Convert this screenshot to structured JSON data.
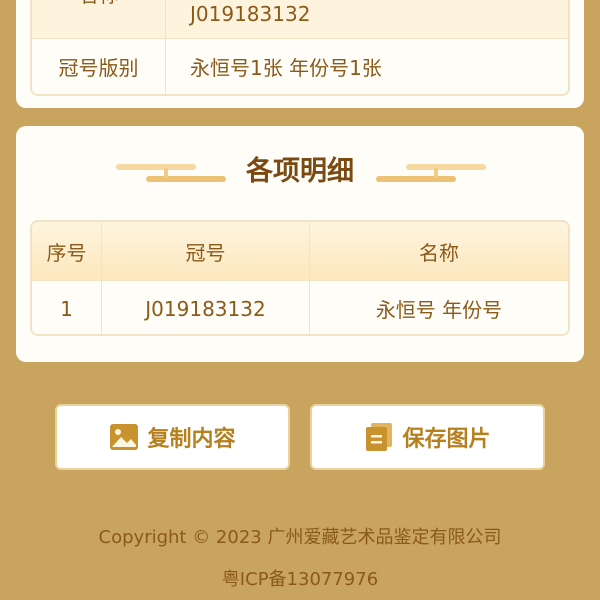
{
  "info_card": {
    "rows": [
      {
        "label": "名称",
        "value": "J019183132"
      },
      {
        "label": "冠号版别",
        "value": "永恒号1张 年份号1张"
      }
    ]
  },
  "detail_card": {
    "title": "各项明细",
    "columns": [
      "序号",
      "冠号",
      "名称"
    ],
    "rows": [
      {
        "index": "1",
        "serial": "J019183132",
        "name": "永恒号 年份号"
      }
    ]
  },
  "actions": {
    "copy_label": "复制内容",
    "copy_icon": "image-icon",
    "save_label": "保存图片",
    "save_icon": "document-icon"
  },
  "footer": {
    "copyright": "Copyright © 2023 广州爱藏艺术品鉴定有限公司",
    "icp": "粤ICP备13077976"
  },
  "colors": {
    "page_background": "#c9a45f",
    "card_background": "#fffdf8",
    "text_brown": "#8b5a1a",
    "accent_gold": "#b6801f",
    "table_border": "#f1e3c3"
  }
}
